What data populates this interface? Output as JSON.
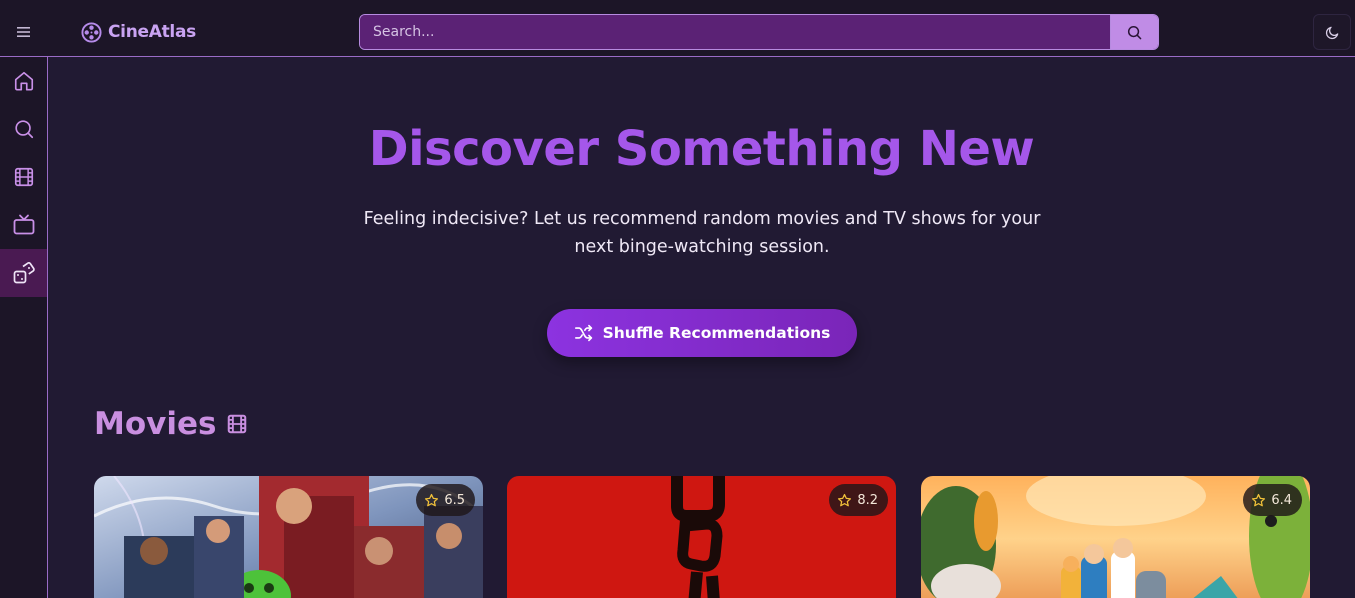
{
  "header": {
    "app_name": "CineAtlas",
    "search_placeholder": "Search..."
  },
  "sidebar": {
    "items": [
      {
        "name": "home",
        "icon": "home-icon"
      },
      {
        "name": "search",
        "icon": "search-icon"
      },
      {
        "name": "movies",
        "icon": "film-icon"
      },
      {
        "name": "tv",
        "icon": "tv-icon"
      },
      {
        "name": "random",
        "icon": "dice-icon",
        "active": true
      }
    ]
  },
  "hero": {
    "title": "Discover Something New",
    "subtitle": "Feeling indecisive? Let us recommend random movies and TV shows for your next binge-watching session.",
    "button_label": "Shuffle Recommendations"
  },
  "sections": {
    "movies_title": "Movies"
  },
  "movies": [
    {
      "rating": "6.5"
    },
    {
      "rating": "8.2"
    },
    {
      "rating": "6.4"
    }
  ],
  "colors": {
    "accent": "#a557ea",
    "background": "#211a33",
    "sidebar_active": "#4a1a52"
  }
}
